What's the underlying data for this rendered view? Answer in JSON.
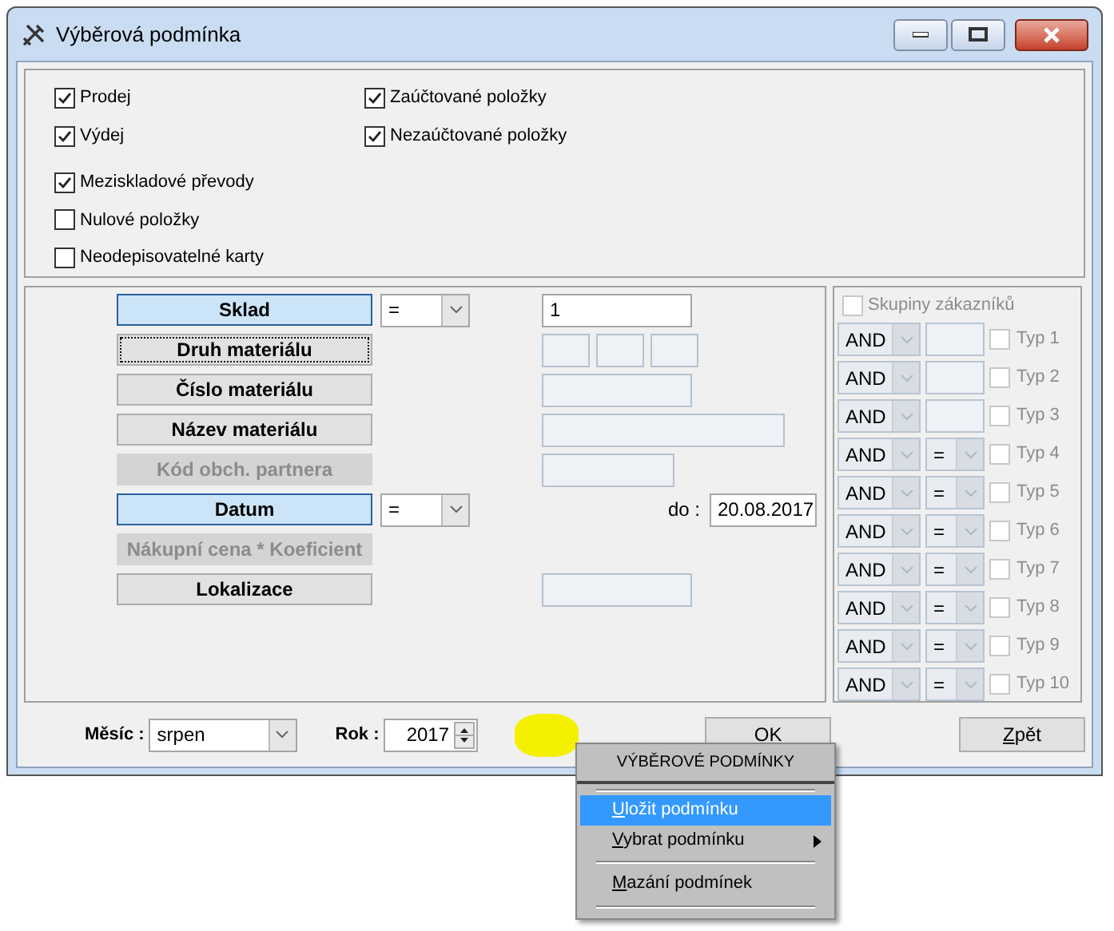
{
  "window": {
    "title": "Výběrová podmínka"
  },
  "options": [
    [
      {
        "label": "Prodej",
        "checked": true
      },
      {
        "label": "Zaúčtované položky",
        "checked": true
      }
    ],
    [
      {
        "label": "Výdej",
        "checked": true
      },
      {
        "label": "Nezaúčtované položky",
        "checked": true
      }
    ],
    [
      {
        "label": "Meziskladové převody",
        "checked": true
      }
    ],
    [
      {
        "label": "Nulové položky",
        "checked": false
      }
    ],
    [
      {
        "label": "Neodepisovatelné karty",
        "checked": false
      }
    ]
  ],
  "conditions": [
    {
      "label": "Sklad",
      "selected": true,
      "disabled": false,
      "focused": false,
      "operator": "=",
      "fields": [
        {
          "kind": "medium",
          "enabled": true,
          "value": "1"
        }
      ]
    },
    {
      "label": "Druh materiálu",
      "selected": false,
      "disabled": false,
      "focused": true,
      "fields": [
        {
          "kind": "small",
          "enabled": false
        },
        {
          "kind": "small",
          "enabled": false
        },
        {
          "kind": "small",
          "enabled": false
        }
      ]
    },
    {
      "label": "Číslo materiálu",
      "selected": false,
      "disabled": false,
      "focused": false,
      "fields": [
        {
          "kind": "medium",
          "enabled": false
        }
      ]
    },
    {
      "label": "Název materiálu",
      "selected": false,
      "disabled": false,
      "focused": false,
      "fields": [
        {
          "kind": "long",
          "enabled": false
        }
      ]
    },
    {
      "label": "Kód obch. partnera",
      "selected": false,
      "disabled": true,
      "focused": false,
      "fields": [
        {
          "kind": "short",
          "enabled": false
        }
      ]
    },
    {
      "label": "Datum",
      "selected": true,
      "disabled": false,
      "focused": false,
      "operator": "=",
      "range_label": "do :",
      "fields": [
        {
          "kind": "date",
          "enabled": true,
          "value": "20.08.2017"
        }
      ]
    },
    {
      "label": "Nákupní cena * Koeficient",
      "selected": false,
      "disabled": true,
      "focused": false
    },
    {
      "label": "Lokalizace",
      "selected": false,
      "disabled": false,
      "focused": false,
      "fields": [
        {
          "kind": "medium",
          "enabled": false
        }
      ]
    }
  ],
  "customer_groups": {
    "label": "Skupiny zákazníků",
    "checked": false,
    "disabled": true,
    "rows": [
      {
        "logic": "AND",
        "kind": "field",
        "label": "Typ 1",
        "checked": false
      },
      {
        "logic": "AND",
        "kind": "field",
        "label": "Typ 2",
        "checked": false
      },
      {
        "logic": "AND",
        "kind": "field",
        "label": "Typ 3",
        "checked": false
      },
      {
        "logic": "AND",
        "kind": "combo",
        "operator": "=",
        "label": "Typ 4",
        "checked": false
      },
      {
        "logic": "AND",
        "kind": "combo",
        "operator": "=",
        "label": "Typ 5",
        "checked": false
      },
      {
        "logic": "AND",
        "kind": "combo",
        "operator": "=",
        "label": "Typ 6",
        "checked": false
      },
      {
        "logic": "AND",
        "kind": "combo",
        "operator": "=",
        "label": "Typ 7",
        "checked": false
      },
      {
        "logic": "AND",
        "kind": "combo",
        "operator": "=",
        "label": "Typ 8",
        "checked": false
      },
      {
        "logic": "AND",
        "kind": "combo",
        "operator": "=",
        "label": "Typ 9",
        "checked": false
      },
      {
        "logic": "AND",
        "kind": "combo",
        "operator": "=",
        "label": "Typ 10",
        "checked": false
      }
    ]
  },
  "footer": {
    "month_label": "Měsíc :",
    "month": "srpen",
    "year_label": "Rok :",
    "year": "2017",
    "buttons": [
      "OK",
      "Zpět"
    ]
  },
  "context_menu": {
    "title": "VÝBĚROVÉ PODMÍNKY",
    "items": [
      {
        "label": "Uložit podmínku",
        "selected": true,
        "submenu": false
      },
      {
        "label": "Vybrat podmínku",
        "selected": false,
        "submenu": true
      },
      {
        "label": "Mazání podmínek",
        "selected": false,
        "submenu": false
      }
    ]
  }
}
